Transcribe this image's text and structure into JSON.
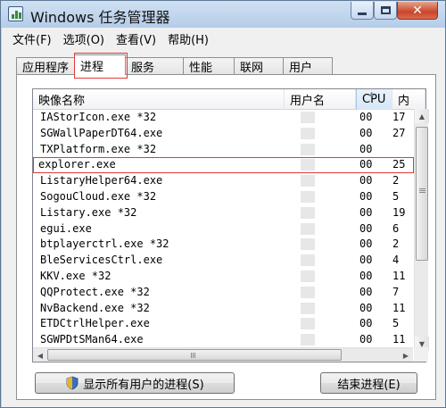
{
  "window": {
    "title": "Windows 任务管理器",
    "close_glyph": "✕"
  },
  "menu": [
    "文件(F)",
    "选项(O)",
    "查看(V)",
    "帮助(H)"
  ],
  "tabs": [
    "应用程序",
    "进程",
    "服务",
    "性能",
    "联网",
    "用户"
  ],
  "active_tab": "进程",
  "columns": {
    "name": "映像名称",
    "user": "用户名",
    "cpu": "CPU",
    "mem": "内"
  },
  "rows": [
    {
      "name": "IAStorIcon.exe *32",
      "cpu": "00",
      "mem": "17"
    },
    {
      "name": "SGWallPaperDT64.exe",
      "cpu": "00",
      "mem": "27"
    },
    {
      "name": "TXPlatform.exe *32",
      "cpu": "00",
      "mem": ""
    },
    {
      "name": "explorer.exe",
      "cpu": "00",
      "mem": "25"
    },
    {
      "name": "ListaryHelper64.exe",
      "cpu": "00",
      "mem": "2"
    },
    {
      "name": "SogouCloud.exe *32",
      "cpu": "00",
      "mem": "5"
    },
    {
      "name": "Listary.exe *32",
      "cpu": "00",
      "mem": "19"
    },
    {
      "name": "egui.exe",
      "cpu": "00",
      "mem": "6"
    },
    {
      "name": "btplayerctrl.exe *32",
      "cpu": "00",
      "mem": "2"
    },
    {
      "name": "BleServicesCtrl.exe",
      "cpu": "00",
      "mem": "4"
    },
    {
      "name": "KKV.exe *32",
      "cpu": "00",
      "mem": "11"
    },
    {
      "name": "QQProtect.exe *32",
      "cpu": "00",
      "mem": "7"
    },
    {
      "name": "NvBackend.exe *32",
      "cpu": "00",
      "mem": "11"
    },
    {
      "name": "ETDCtrlHelper.exe",
      "cpu": "00",
      "mem": "5"
    },
    {
      "name": "SGWPDtSMan64.exe",
      "cpu": "00",
      "mem": "11"
    }
  ],
  "selected_row": "explorer.exe",
  "buttons": {
    "show_all": "显示所有用户的进程(S)",
    "end_process": "结束进程(E)"
  },
  "icons": {
    "app": "task-manager-icon",
    "shield": "uac-shield-icon"
  },
  "colors": {
    "highlight": "#e03a3a",
    "title_bg": "#bcd2ea",
    "close_btn": "#c9452a"
  }
}
